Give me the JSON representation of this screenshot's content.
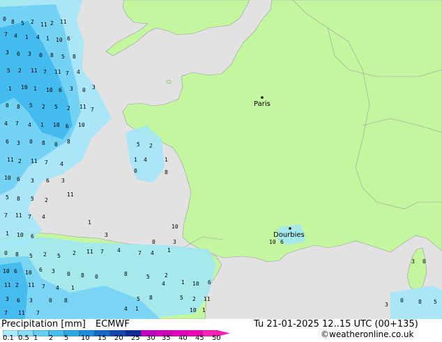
{
  "title_left": "Precipitation [mm]",
  "model": "ECMWF",
  "valid_time": "Tu 21-01-2025 12..15 UTC (00+135)",
  "credit": "©weatheronline.co.uk",
  "cities": [
    {
      "name": "Paris"
    },
    {
      "name": "Dourbies"
    }
  ],
  "legend": {
    "ticks": [
      "0.1",
      "0.5",
      "1",
      "2",
      "5",
      "10",
      "15",
      "20",
      "25",
      "30",
      "35",
      "40",
      "45",
      "50"
    ],
    "colors": [
      "#a8eaff",
      "#88dcf8",
      "#66cef2",
      "#44bcec",
      "#2aa8e4",
      "#1a8edc",
      "#1668c8",
      "#1248b0",
      "#0c2a98",
      "#c400c4",
      "#d400c0",
      "#e400bc",
      "#f000b8",
      "#f820b8"
    ]
  },
  "colors": {
    "sea": "#e2e2e2",
    "land": "#c4f6a0",
    "rain_light": "#a0e6fa",
    "rain_mid": "#6ed0f4",
    "rain_heavy": "#3cb6ec"
  },
  "grid_values": [
    "0",
    "1",
    "2",
    "3",
    "4",
    "5",
    "6",
    "7",
    "8",
    "10",
    "11"
  ]
}
